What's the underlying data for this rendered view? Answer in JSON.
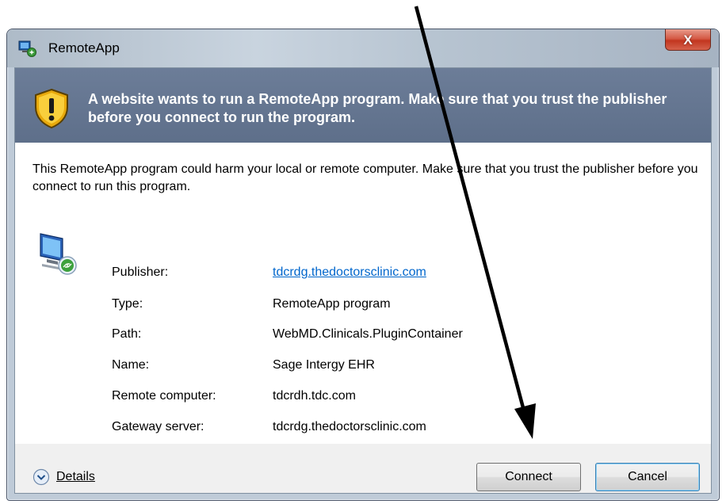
{
  "window": {
    "title": "RemoteApp",
    "close_label": "X"
  },
  "banner": {
    "text": "A website wants to run a RemoteApp program. Make sure that you trust the publisher before you connect to run the program."
  },
  "warning": {
    "text": "This RemoteApp program could harm your local or remote computer. Make sure that you trust the publisher before you connect to run this program."
  },
  "properties": [
    {
      "label": "Publisher:",
      "value": "tdcrdg.thedoctorsclinic.com"
    },
    {
      "label": "Type:",
      "value": "RemoteApp program"
    },
    {
      "label": "Path:",
      "value": "WebMD.Clinicals.PluginContainer"
    },
    {
      "label": "Name:",
      "value": "Sage Intergy EHR"
    },
    {
      "label": "Remote computer:",
      "value": "tdcrdh.tdc.com"
    },
    {
      "label": "Gateway server:",
      "value": "tdcrdg.thedoctorsclinic.com"
    }
  ],
  "footer": {
    "details_label": "Details",
    "connect_label": "Connect",
    "cancel_label": "Cancel"
  },
  "colors": {
    "banner": "#5e6f8a",
    "link": "#0066cc",
    "close": "#c2361f",
    "annotation_arrow": "#000000"
  }
}
